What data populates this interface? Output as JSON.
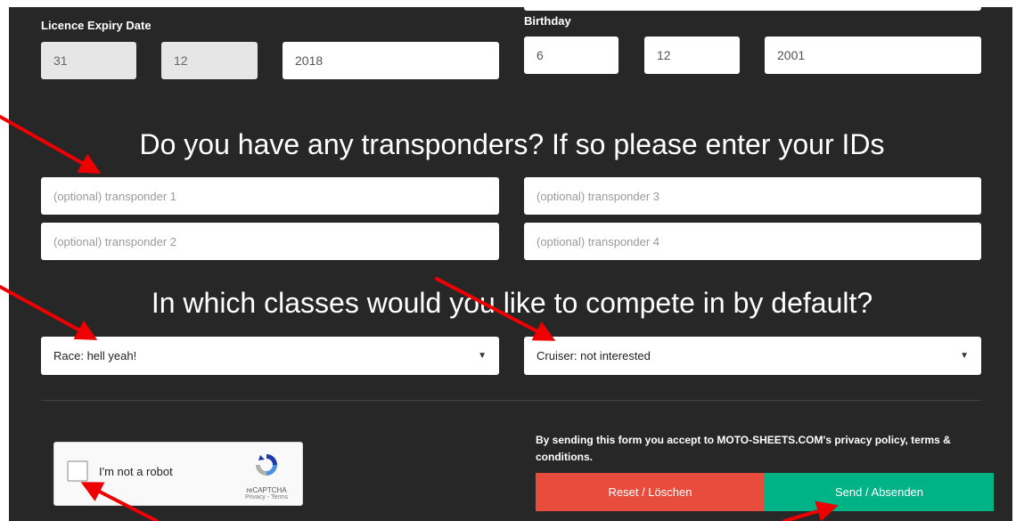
{
  "license": {
    "label": "Licence Expiry Date",
    "day": "31",
    "month": "12",
    "year": "2018"
  },
  "birthday": {
    "label": "Birthday",
    "day": "6",
    "month": "12",
    "year": "2001"
  },
  "transponders": {
    "heading": "Do you have any transponders? If so please enter your IDs",
    "placeholders": [
      "(optional) transponder 1",
      "(optional) transponder 2",
      "(optional) transponder 3",
      "(optional) transponder 4"
    ]
  },
  "classes": {
    "heading": "In which classes would you like to compete in by default?",
    "race_value": "Race: hell yeah!",
    "cruiser_value": "Cruiser: not interested"
  },
  "captcha": {
    "label": "I'm not a robot",
    "brand": "reCAPTCHA",
    "links": "Privacy - Terms"
  },
  "consent_text": "By sending this form you accept to MOTO-SHEETS.COM's privacy policy, terms & conditions.",
  "buttons": {
    "reset": "Reset / Löschen",
    "send": "Send / Absenden"
  },
  "colors": {
    "background": "#272727",
    "reset": "#e74c3c",
    "send": "#00b386",
    "annotation_arrow": "#ee0000"
  },
  "icons": {
    "select_caret": "caret-down-icon",
    "captcha_logo": "recaptcha-icon"
  }
}
